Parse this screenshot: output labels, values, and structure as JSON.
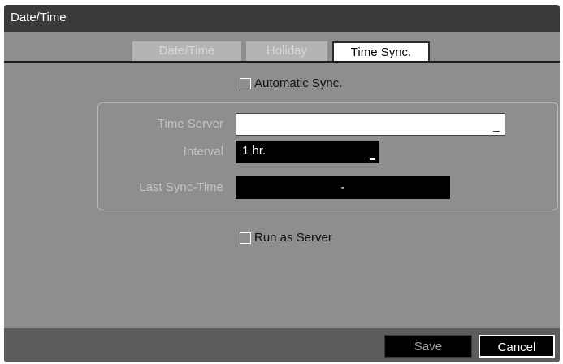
{
  "window": {
    "title": "Date/Time"
  },
  "tabs": [
    {
      "label": "Date/Time",
      "active": false
    },
    {
      "label": "Holiday",
      "active": false
    },
    {
      "label": "Time Sync.",
      "active": true
    }
  ],
  "automatic_sync": {
    "label": "Automatic Sync.",
    "checked": false
  },
  "fields": {
    "time_server": {
      "label": "Time Server",
      "value": ""
    },
    "interval": {
      "label": "Interval",
      "value": "1 hr."
    },
    "last_sync": {
      "label": "Last Sync-Time",
      "value": "-"
    }
  },
  "run_as_server": {
    "label": "Run as Server",
    "checked": false
  },
  "buttons": {
    "save": "Save",
    "cancel": "Cancel"
  }
}
